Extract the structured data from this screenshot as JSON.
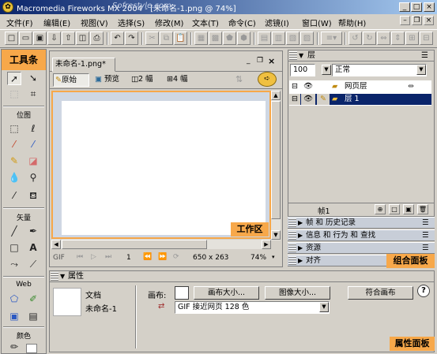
{
  "window": {
    "title": "Macromedia Fireworks MX 2004 - [未命名-1.png @  74%]",
    "watermark": "Sofrestyle.com",
    "min": "_",
    "max": "□",
    "close": "×"
  },
  "menu": {
    "items": [
      "文件(F)",
      "编辑(E)",
      "视图(V)",
      "选择(S)",
      "修改(M)",
      "文本(T)",
      "命令(C)",
      "滤镜(I)",
      "窗口(W)",
      "帮助(H)"
    ]
  },
  "tools": {
    "title": "工具条",
    "section_bitmap": "位图",
    "section_vector": "矢量",
    "section_web": "Web",
    "section_colors": "颜色"
  },
  "document": {
    "tab_title": "未命名-1.png*",
    "view_original": "原始",
    "view_preview": "预览",
    "view_2up": "2 幅",
    "view_4up": "4 幅",
    "work_area_label": "工作区",
    "status": {
      "format": "GIF",
      "frame": "1",
      "size": "650 x 263",
      "zoom": "74%"
    }
  },
  "layers_panel": {
    "title": "层",
    "opacity": "100",
    "blend_mode": "正常",
    "rows": [
      {
        "name": "网页层"
      },
      {
        "name": "层 1"
      }
    ],
    "frame_label": "帧1",
    "group_label": "组合面板"
  },
  "collapsed_panels": [
    "帧 和 历史记录",
    "信息 和 行为 和 查找",
    "资源",
    "对齐"
  ],
  "properties": {
    "title": "属性",
    "doc_label": "文档",
    "doc_name": "未命名-1",
    "canvas_label": "画布:",
    "canvas_size_btn": "画布大小...",
    "image_size_btn": "图像大小...",
    "fit_canvas_btn": "符合画布",
    "export_format": "GIF 接近网页 128 色",
    "panel_label": "属性面板"
  },
  "colors": {
    "highlight": "#f7a84a",
    "titlebar": "#0a246a",
    "selection": "#0a246a"
  }
}
